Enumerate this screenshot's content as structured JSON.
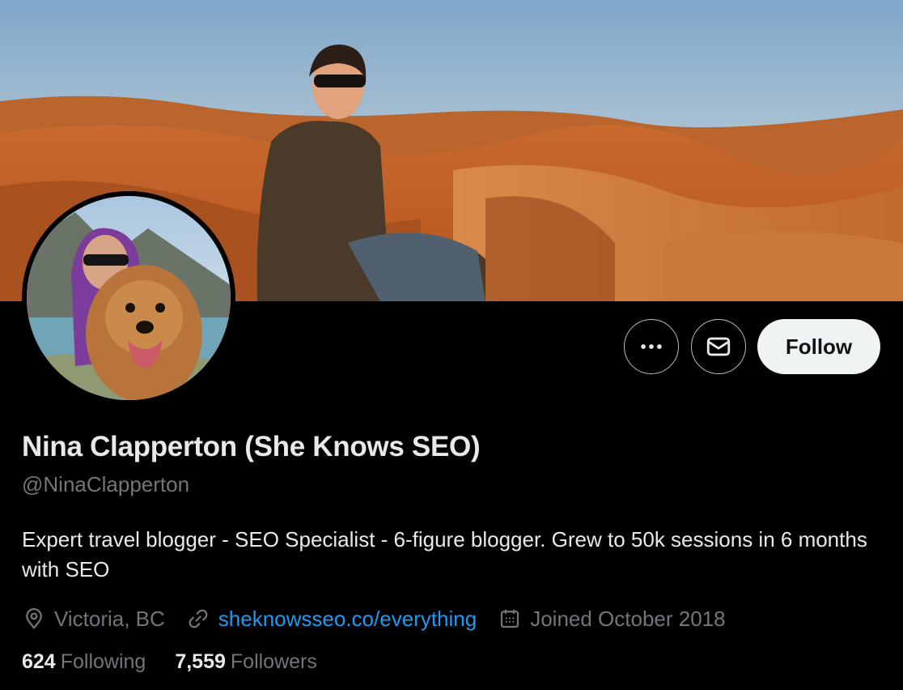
{
  "profile": {
    "name": "Nina Clapperton (She Knows SEO)",
    "handle": "@NinaClapperton",
    "bio": "Expert travel blogger - SEO Specialist - 6-figure blogger. Grew to 50k sessions in 6 months with SEO",
    "location": "Victoria, BC",
    "website": "sheknowsseo.co/everything",
    "joined": "Joined October 2018"
  },
  "stats": {
    "following_count": "624",
    "following_label": "Following",
    "followers_count": "7,559",
    "followers_label": "Followers"
  },
  "actions": {
    "follow_label": "Follow",
    "more_icon": "more-horizontal-icon",
    "message_icon": "envelope-icon"
  },
  "icons": {
    "location": "location-pin-icon",
    "link": "link-icon",
    "calendar": "calendar-icon"
  },
  "colors": {
    "background": "#000000",
    "text_primary": "#e7e9ea",
    "text_secondary": "#71767b",
    "link": "#1d9bf0",
    "follow_bg": "#eff3f4"
  }
}
